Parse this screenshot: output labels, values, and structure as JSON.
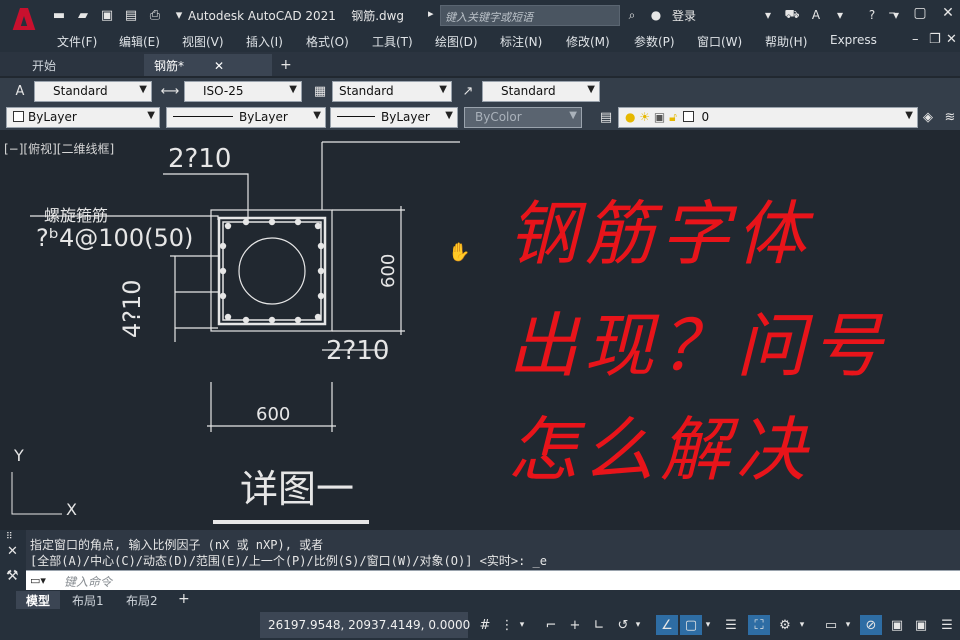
{
  "title": {
    "app_name": "Autodesk AutoCAD 2021",
    "file_name": "钢筋.dwg",
    "search_placeholder": "键入关键字或短语",
    "login_label": "登录"
  },
  "menu": [
    "文件(F)",
    "编辑(E)",
    "视图(V)",
    "插入(I)",
    "格式(O)",
    "工具(T)",
    "绘图(D)",
    "标注(N)",
    "修改(M)",
    "参数(P)",
    "窗口(W)",
    "帮助(H)",
    "Express"
  ],
  "tabs": {
    "start": "开始",
    "drawing": "钢筋*"
  },
  "toolbar1": {
    "text_style": "Standard",
    "dim_style": "ISO-25",
    "table_style": "Standard",
    "mleader_style": "Standard"
  },
  "toolbar2": {
    "color": "ByLayer",
    "linetype": "ByLayer",
    "lineweight": "ByLayer",
    "plotstyle": "ByColor",
    "layer": "0"
  },
  "viewport_label": "[−][俯视][二维线框]",
  "drawing_text": {
    "rebar_top": "2?10",
    "spiral_label": "螺旋箍筋",
    "stirrup": "?ᵇ4@100(50)",
    "rebar_side": "4?10",
    "rebar_bottom": "2?10",
    "dim_height": "600",
    "dim_width": "600",
    "detail_title": "详图一",
    "ucs_y": "Y",
    "ucs_x": "X"
  },
  "overlay_lines": [
    "钢筋字体",
    "出现？问号",
    "怎么解决"
  ],
  "command": {
    "line1": "指定窗口的角点, 输入比例因子 (nX 或 nXP), 或者",
    "line2": "[全部(A)/中心(C)/动态(D)/范围(E)/上一个(P)/比例(S)/窗口(W)/对象(O)] <实时>: _e",
    "placeholder": "键入命令"
  },
  "layout_tabs": [
    "模型",
    "布局1",
    "布局2"
  ],
  "status": {
    "coordinates": "26197.9548, 20937.4149, 0.0000"
  },
  "colors": {
    "overlay_red": "#e8141a",
    "accent_blue": "#2e6da4",
    "logo_red": "#c8102e"
  }
}
